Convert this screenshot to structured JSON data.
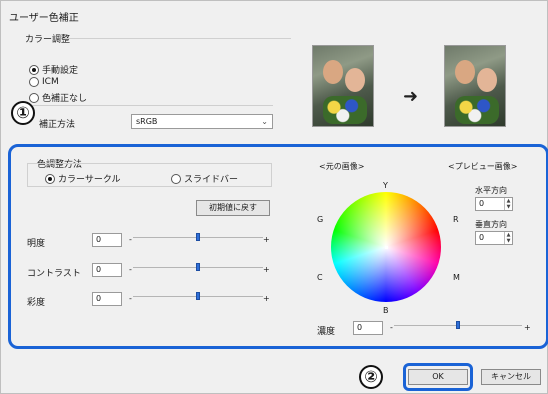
{
  "window": {
    "title": "ユーザー色補正"
  },
  "color_adjust": {
    "section_label": "カラー調整",
    "options": [
      "手動設定",
      "ICM",
      "色補正なし"
    ],
    "selected": "手動設定",
    "method_label": "補正方法",
    "method_value": "sRGB"
  },
  "preview": {
    "original_label": "<元の画像>",
    "preview_label": "<プレビュー画像>"
  },
  "adjust_method": {
    "label": "色調整方法",
    "color_circle": "カラーサークル",
    "slide_bar": "スライドバー",
    "selected": "カラーサークル",
    "reset_button": "初期値に戻す"
  },
  "sliders": [
    {
      "label": "明度",
      "value": "0",
      "level": 0.5
    },
    {
      "label": "コントラスト",
      "value": "0",
      "level": 0.5
    },
    {
      "label": "彩度",
      "value": "0",
      "level": 0.5
    }
  ],
  "slider_ends": {
    "minus": "-",
    "plus": "+"
  },
  "wheel": {
    "Y": "Y",
    "G": "G",
    "R": "R",
    "C": "C",
    "M": "M",
    "B": "B"
  },
  "direction": {
    "horizontal_label": "水平方向",
    "horizontal_value": "0",
    "vertical_label": "垂直方向",
    "vertical_value": "0"
  },
  "density": {
    "label": "濃度",
    "value": "0",
    "level": 0.5
  },
  "buttons": {
    "ok": "OK",
    "cancel": "キャンセル"
  },
  "callouts": {
    "one": "①",
    "two": "②"
  },
  "colors": {
    "highlight": "#1a63d6",
    "slider_thumb": "#2f6fd8"
  }
}
